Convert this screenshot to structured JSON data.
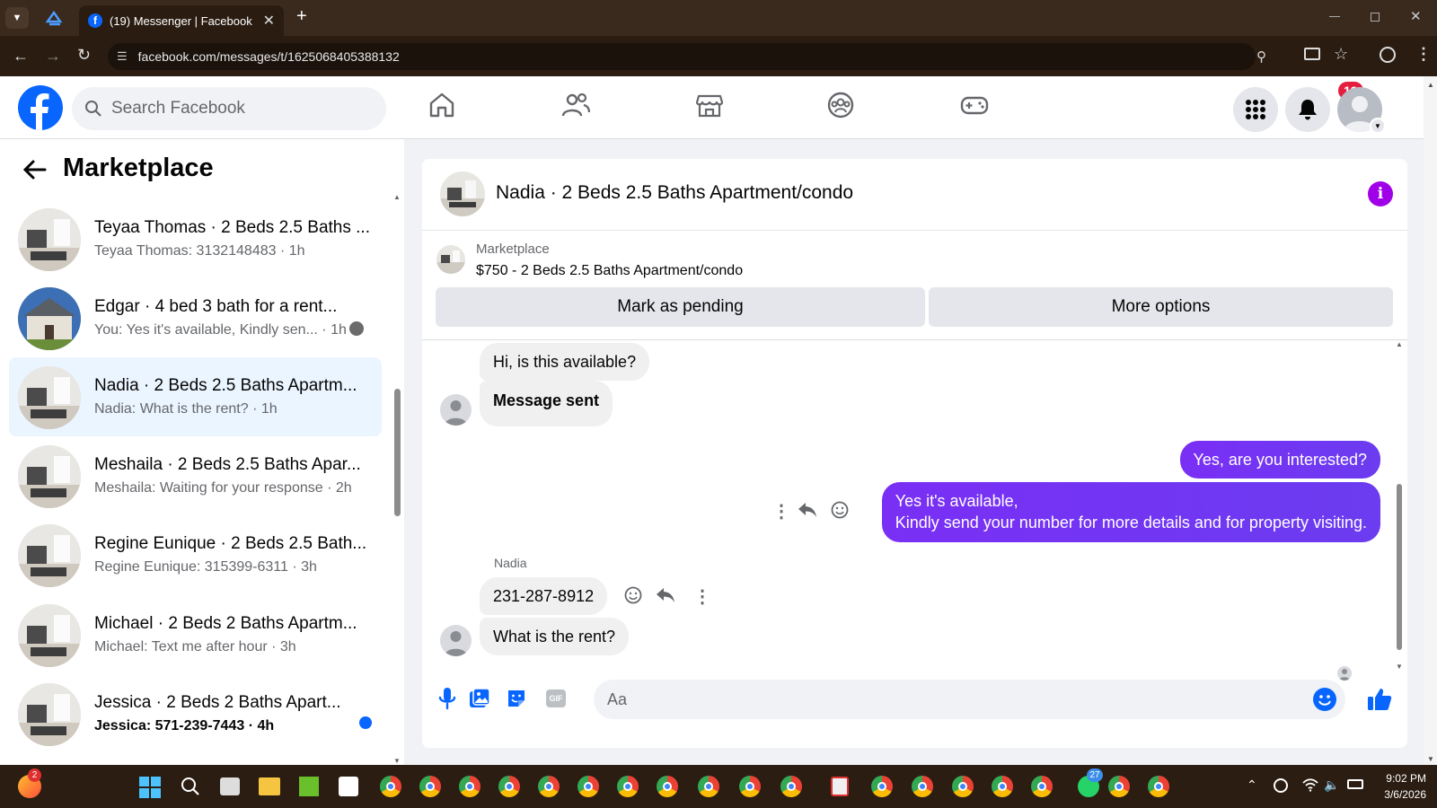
{
  "browser": {
    "tab_title": "(19) Messenger | Facebook",
    "url": "facebook.com/messages/t/1625068405388132"
  },
  "header": {
    "search_placeholder": "Search Facebook",
    "notification_count": "19"
  },
  "sidebar": {
    "title": "Marketplace",
    "conversations": [
      {
        "title": "Teyaa Thomas · 2 Beds 2.5 Baths ...",
        "subtitle": "Teyaa Thomas: 3132148483 · 1h",
        "active": false,
        "unread": false
      },
      {
        "title": "Edgar · 4 bed 3 bath for a rent...",
        "subtitle": "You: Yes it's available, Kindly sen... · 1h",
        "active": false,
        "unread": false
      },
      {
        "title": "Nadia · 2 Beds 2.5 Baths Apartm...",
        "subtitle": "Nadia: What is the rent? · 1h",
        "active": true,
        "unread": false
      },
      {
        "title": "Meshaila · 2 Beds 2.5 Baths Apar...",
        "subtitle": "Meshaila: Waiting for your response · 2h",
        "active": false,
        "unread": false
      },
      {
        "title": "Regine Eunique · 2 Beds 2.5 Bath...",
        "subtitle": "Regine Eunique: 315399-6311 · 3h",
        "active": false,
        "unread": false
      },
      {
        "title": "Michael · 2 Beds 2 Baths Apartm...",
        "subtitle": "Michael: Text me after hour · 3h",
        "active": false,
        "unread": false
      },
      {
        "title": "Jessica · 2 Beds 2 Baths Apart...",
        "subtitle": "Jessica: 571-239-7443 · 4h",
        "active": false,
        "unread": true
      }
    ]
  },
  "chat": {
    "title": "Nadia · 2 Beds 2.5 Baths Apartment/condo",
    "listing_source": "Marketplace",
    "listing_title": "$750 - 2 Beds 2.5 Baths Apartment/condo",
    "mark_pending_label": "Mark as pending",
    "more_options_label": "More options",
    "messages": {
      "m1": "Hi, is this available?",
      "m2": "Message sent",
      "m3": "Yes, are you interested?",
      "m4_line1": "Yes it's available,",
      "m4_line2": "Kindly send your number for more details and for property visiting.",
      "sender": "Nadia",
      "m5": "231-287-8912",
      "m6": "What is the rent?"
    },
    "composer_placeholder": "Aa"
  },
  "taskbar": {
    "time": "9:02 PM",
    "date": "3/6/2026",
    "firefox_badge": "2",
    "whatsapp_badge": "27"
  },
  "colors": {
    "fb_blue": "#0866ff",
    "messenger_purple": "#7a2ff5",
    "notification_red": "#e41e3f"
  }
}
